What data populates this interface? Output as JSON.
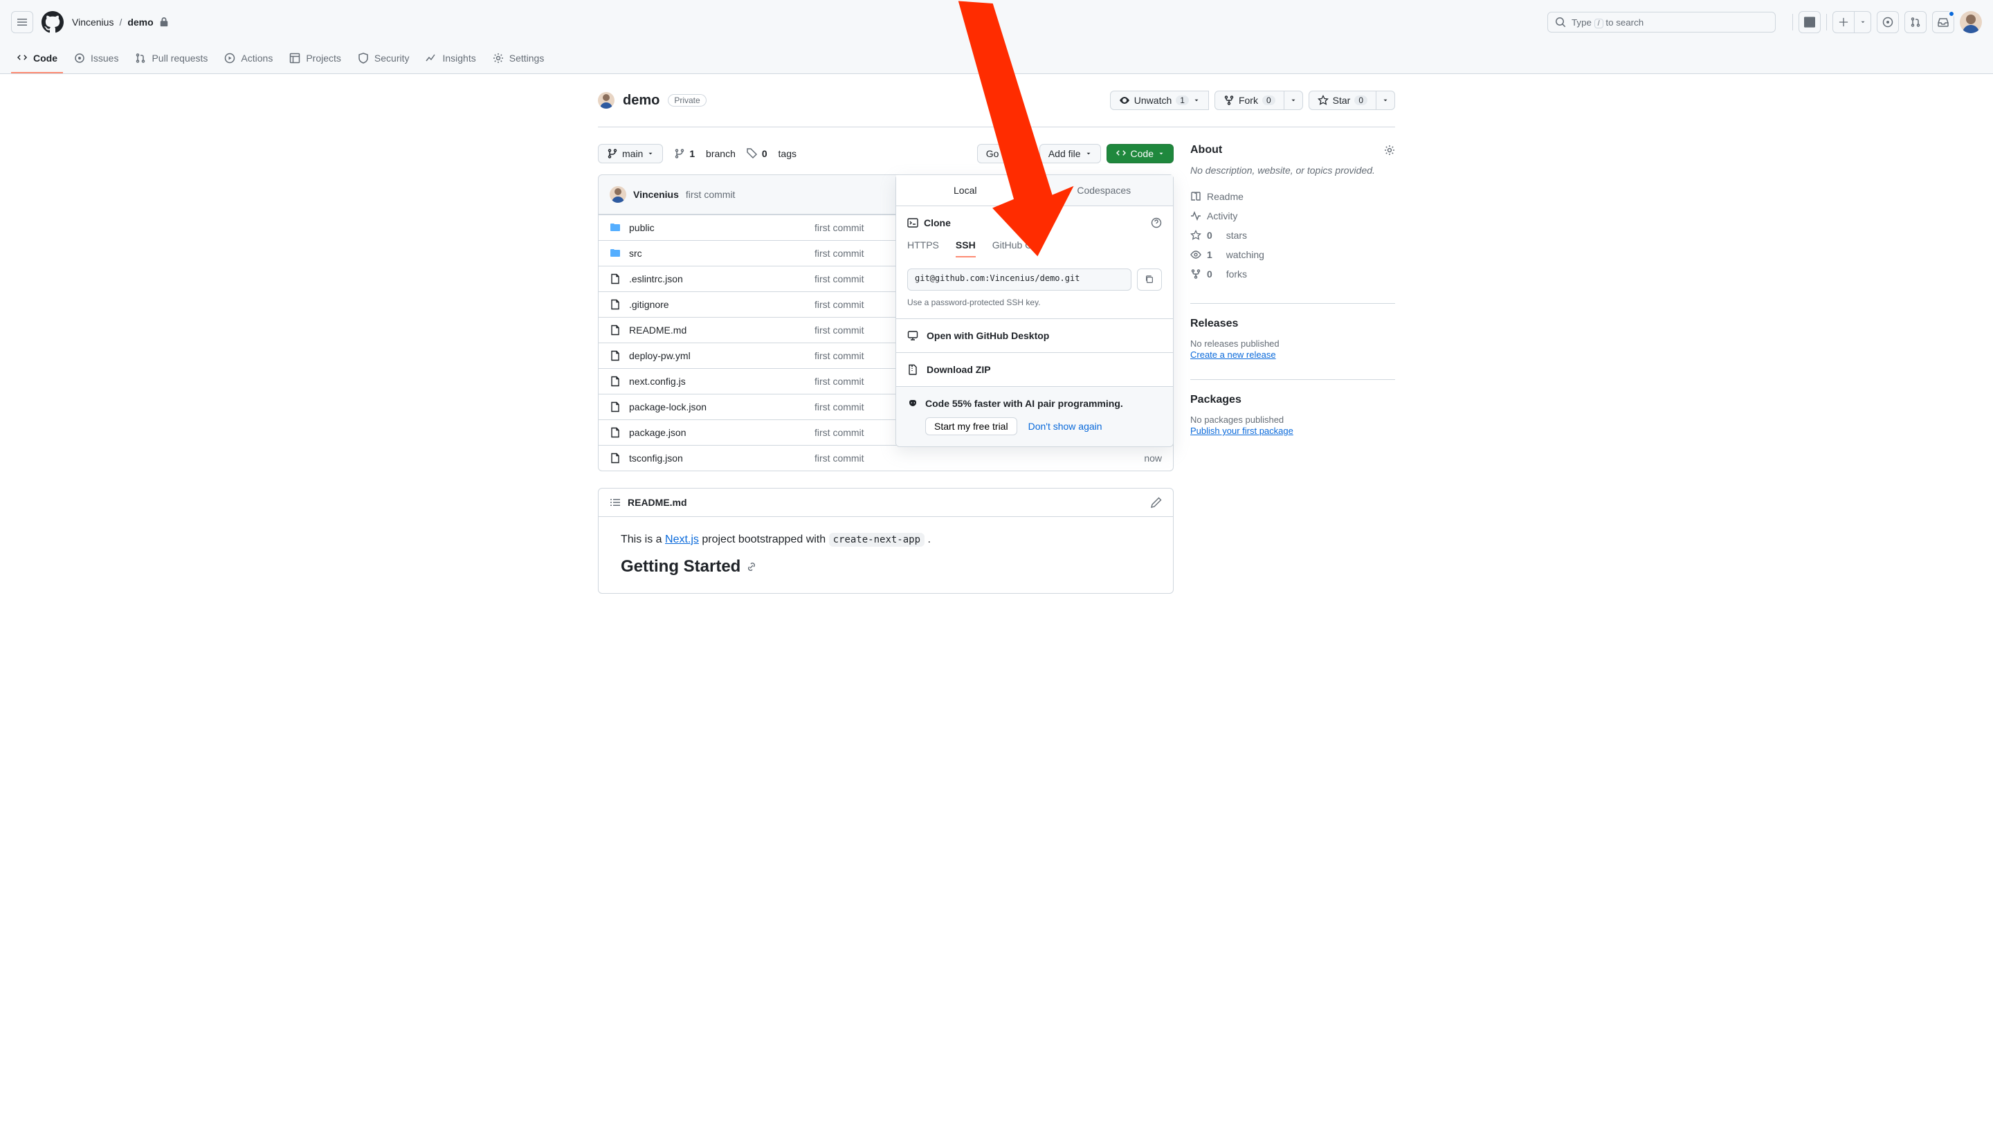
{
  "header": {
    "breadcrumb_owner": "Vincenius",
    "breadcrumb_repo": "demo",
    "search_placeholder": "Type",
    "search_suffix": "to search",
    "search_kbd": "/"
  },
  "nav": {
    "code": "Code",
    "issues": "Issues",
    "pulls": "Pull requests",
    "actions": "Actions",
    "projects": "Projects",
    "security": "Security",
    "insights": "Insights",
    "settings": "Settings"
  },
  "repo": {
    "name": "demo",
    "visibility": "Private",
    "unwatch": "Unwatch",
    "watch_count": "1",
    "fork": "Fork",
    "fork_count": "0",
    "star": "Star",
    "star_count": "0"
  },
  "file_nav": {
    "branch": "main",
    "branches": "1",
    "branches_label": "branch",
    "tags": "0",
    "tags_label": "tags",
    "go_to_file": "Go to file",
    "add_file": "Add file",
    "code_btn": "Code"
  },
  "commit_bar": {
    "author": "Vincenius",
    "message": "first commit"
  },
  "files": [
    {
      "type": "dir",
      "name": "public",
      "msg": "first commit",
      "time": ""
    },
    {
      "type": "dir",
      "name": "src",
      "msg": "first commit",
      "time": ""
    },
    {
      "type": "file",
      "name": ".eslintrc.json",
      "msg": "first commit",
      "time": ""
    },
    {
      "type": "file",
      "name": ".gitignore",
      "msg": "first commit",
      "time": ""
    },
    {
      "type": "file",
      "name": "README.md",
      "msg": "first commit",
      "time": ""
    },
    {
      "type": "file",
      "name": "deploy-pw.yml",
      "msg": "first commit",
      "time": ""
    },
    {
      "type": "file",
      "name": "next.config.js",
      "msg": "first commit",
      "time": ""
    },
    {
      "type": "file",
      "name": "package-lock.json",
      "msg": "first commit",
      "time": ""
    },
    {
      "type": "file",
      "name": "package.json",
      "msg": "first commit",
      "time": ""
    },
    {
      "type": "file",
      "name": "tsconfig.json",
      "msg": "first commit",
      "time": "now"
    }
  ],
  "readme": {
    "title": "README.md",
    "p1_prefix": "This is a ",
    "p1_link": "Next.js",
    "p1_mid": " project bootstrapped with ",
    "p1_code": "create-next-app",
    "p1_suffix": " .",
    "h2": "Getting Started"
  },
  "about": {
    "title": "About",
    "desc": "No description, website, or topics provided.",
    "readme": "Readme",
    "activity": "Activity",
    "stars_n": "0",
    "stars_l": "stars",
    "watch_n": "1",
    "watch_l": "watching",
    "forks_n": "0",
    "forks_l": "forks"
  },
  "releases": {
    "title": "Releases",
    "empty": "No releases published",
    "link": "Create a new release"
  },
  "packages": {
    "title": "Packages",
    "empty": "No packages published",
    "link": "Publish your first package"
  },
  "dropdown": {
    "tab_local": "Local",
    "tab_codespaces": "Codespaces",
    "clone": "Clone",
    "https": "HTTPS",
    "ssh": "SSH",
    "cli": "GitHub CLI",
    "url": "git@github.com:Vincenius/demo.git",
    "hint": "Use a password-protected SSH key.",
    "desktop": "Open with GitHub Desktop",
    "zip": "Download ZIP",
    "copilot": "Code 55% faster with AI pair programming.",
    "trial": "Start my free trial",
    "dismiss": "Don't show again"
  }
}
